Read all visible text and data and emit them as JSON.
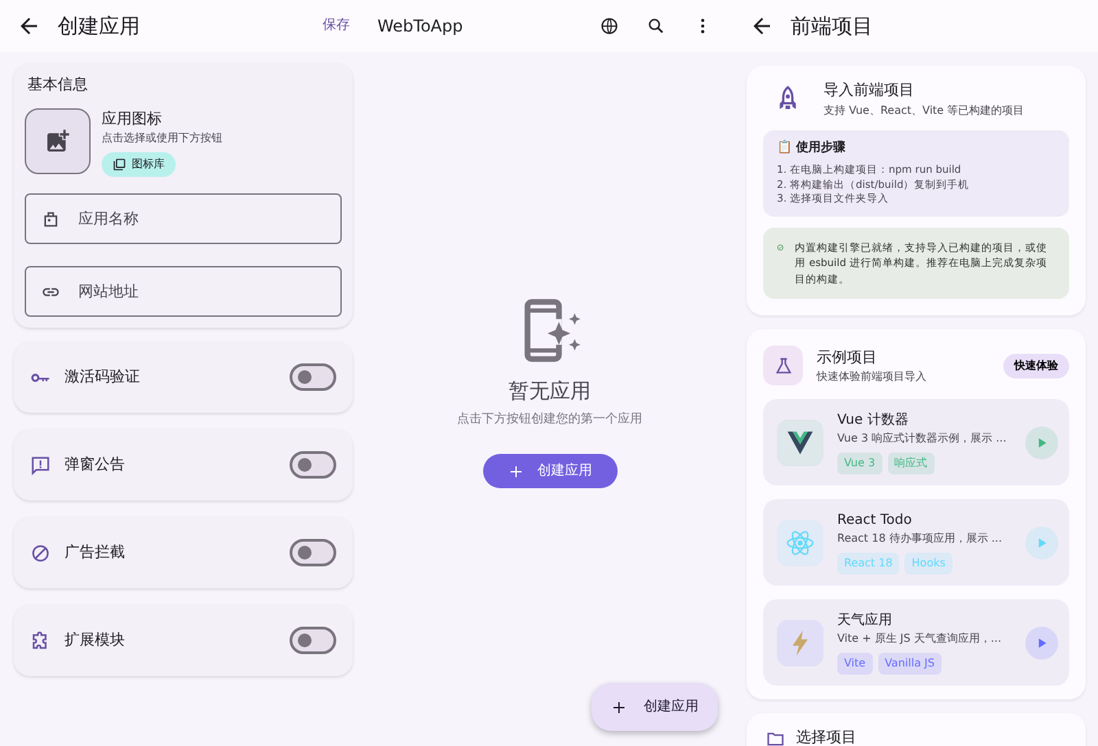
{
  "create_screen": {
    "title": "创建应用",
    "save": "保存",
    "basic_info": {
      "heading": "基本信息",
      "icon_label": "应用图标",
      "icon_hint": "点击选择或使用下方按钮",
      "gallery_button": "图标库",
      "fields": [
        {
          "kind": "name",
          "placeholder": "应用名称"
        },
        {
          "kind": "url",
          "placeholder": "网站地址"
        }
      ]
    },
    "toggles": [
      {
        "kind": "key",
        "label": "激活码验证",
        "on": false
      },
      {
        "kind": "notice",
        "label": "弹窗公告",
        "on": false
      },
      {
        "kind": "block",
        "label": "广告拦截",
        "on": false
      },
      {
        "kind": "puzzle",
        "label": "扩展模块",
        "on": false
      }
    ]
  },
  "home_screen": {
    "title": "WebToApp",
    "empty_title": "暂无应用",
    "empty_hint": "点击下方按钮创建您的第一个应用",
    "create_button": "创建应用",
    "fab": "创建应用"
  },
  "frontend_screen": {
    "title": "前端项目",
    "import": {
      "title": "导入前端项目",
      "subtitle": "支持 Vue、React、Vite 等已构建的项目",
      "steps_title": "📋 使用步骤",
      "steps": [
        "1. 在电脑上构建项目：npm run build",
        "2. 将构建输出（dist/build）复制到手机",
        "3. 选择项目文件夹导入"
      ],
      "note": "内置构建引擎已就绪，支持导入已构建的项目，或使用 esbuild 进行简单构建。推荐在电脑上完成复杂项目的构建。"
    },
    "samples": {
      "title": "示例项目",
      "subtitle": "快速体验前端项目导入",
      "quick_button": "快速体验",
      "projects": [
        {
          "kind": "vue",
          "color": "#41b883",
          "name": "Vue 计数器",
          "description": "Vue 3 响应式计数器示例，展示 ...",
          "tags": [
            "Vue 3",
            "响应式"
          ]
        },
        {
          "kind": "react",
          "color": "#61dafb",
          "name": "React Todo",
          "description": "React 18 待办事项应用，展示 ...",
          "tags": [
            "React 18",
            "Hooks"
          ]
        },
        {
          "kind": "vite",
          "color": "#646cff",
          "name": "天气应用",
          "description": "Vite + 原生 JS 天气查询应用，...",
          "tags": [
            "Vite",
            "Vanilla JS"
          ]
        }
      ]
    },
    "select_title": "选择项目"
  }
}
